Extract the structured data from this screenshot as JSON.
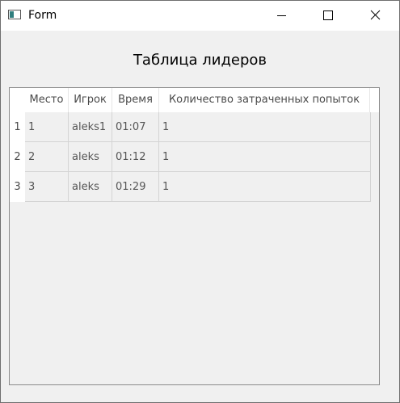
{
  "window": {
    "title": "Form",
    "controls": {
      "minimize_icon": "minimize-icon",
      "maximize_icon": "maximize-icon",
      "close_icon": "close-icon"
    }
  },
  "heading": "Таблица лидеров",
  "table": {
    "columns": [
      "Место",
      "Игрок",
      "Время",
      "Количество затраченных попыток"
    ],
    "row_headers": [
      "1",
      "2",
      "3"
    ],
    "rows": [
      [
        "1",
        "aleks1",
        "01:07",
        "1"
      ],
      [
        "2",
        "aleks",
        "01:12",
        "1"
      ],
      [
        "3",
        "aleks",
        "01:29",
        "1"
      ]
    ]
  },
  "colors": {
    "window_bg": "#f0f0f0",
    "titlebar_bg": "#ffffff",
    "header_bg": "#ffffff",
    "grid_line": "#d4d4d4"
  }
}
